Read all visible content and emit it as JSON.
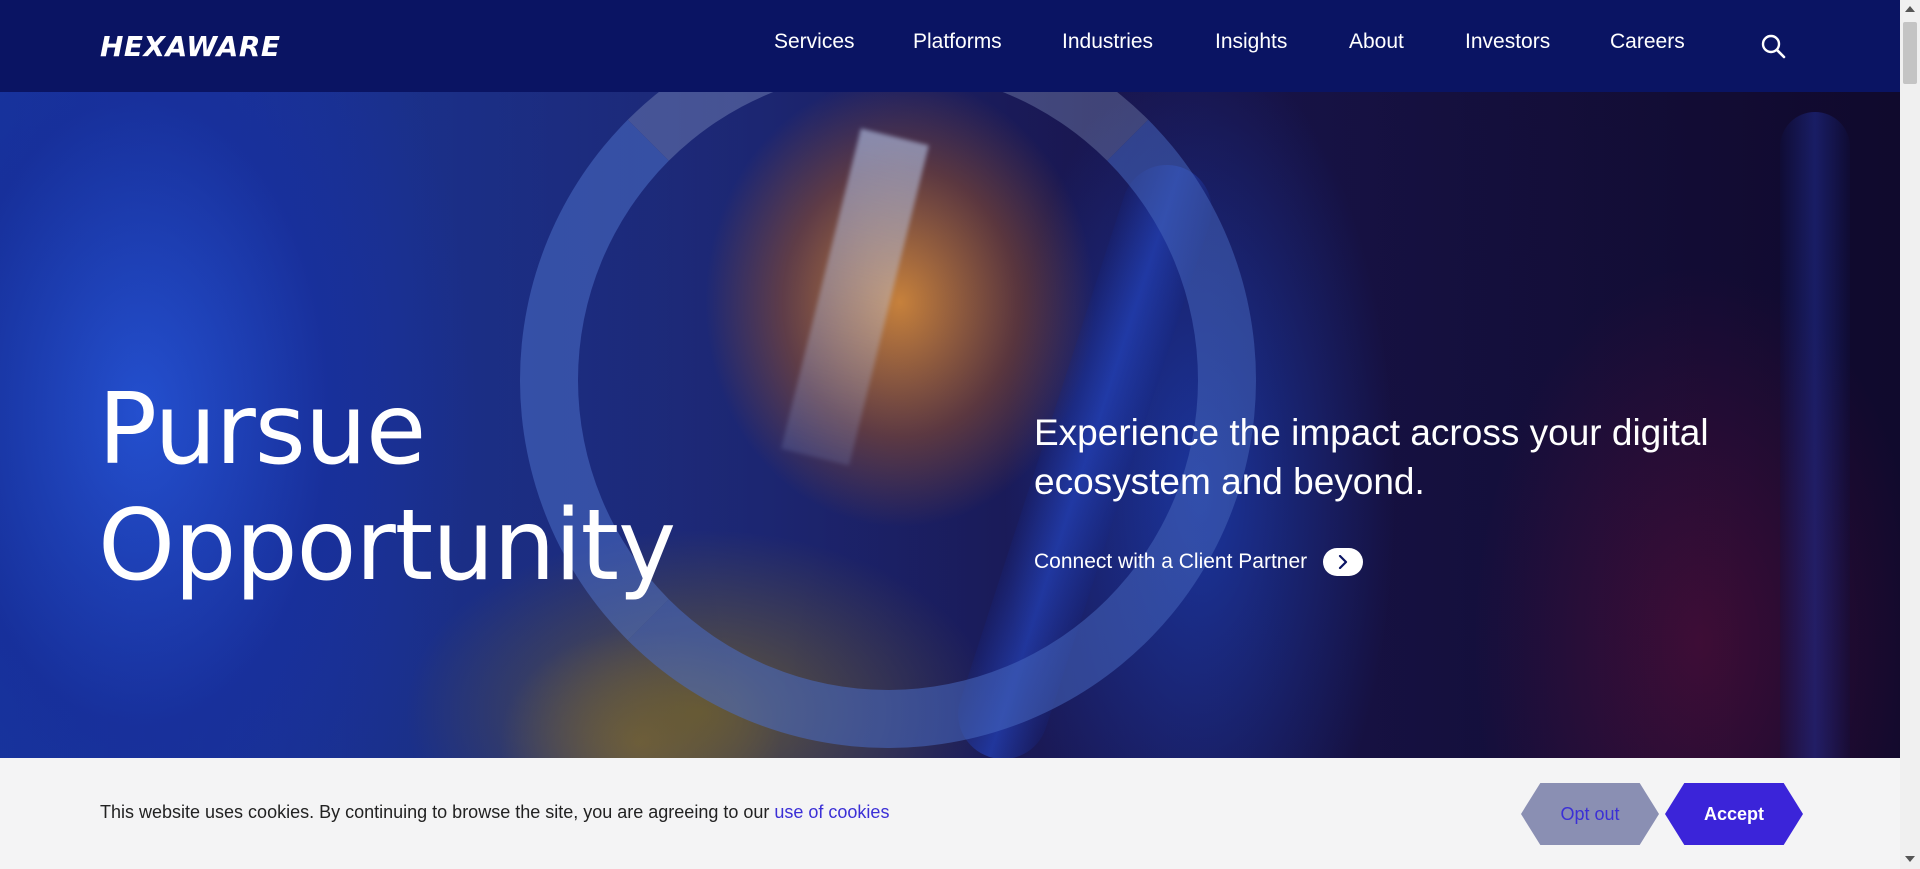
{
  "header": {
    "logo_text": "HEXAWARE",
    "nav": [
      {
        "label": "Services"
      },
      {
        "label": "Platforms"
      },
      {
        "label": "Industries"
      },
      {
        "label": "Insights"
      },
      {
        "label": "About"
      },
      {
        "label": "Investors"
      },
      {
        "label": "Careers"
      }
    ],
    "search_icon": "search-icon"
  },
  "hero": {
    "title_line1": "Pursue",
    "title_line2": "Opportunity",
    "tagline": "Experience the impact across your digital ecosystem and beyond.",
    "cta_label": "Connect with a Client Partner",
    "cta_icon": "chevron-right-icon"
  },
  "cookie": {
    "text": "This website uses cookies. By continuing to browse the site, you are agreeing to our ",
    "link_text": "use of cookies",
    "optout_label": "Opt out",
    "accept_label": "Accept"
  },
  "colors": {
    "header_bg": "#0a1463",
    "accent": "#3b24d9",
    "optout_bg": "#8a8fb3",
    "link": "#3b2fd6"
  }
}
